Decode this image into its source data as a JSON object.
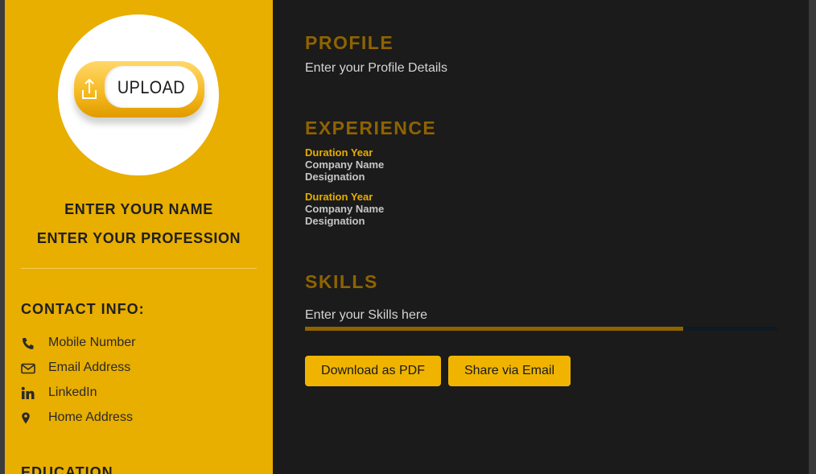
{
  "sidebar": {
    "upload_label": "UPLOAD",
    "name": "ENTER YOUR NAME",
    "profession": "ENTER YOUR PROFESSION",
    "contact_title": "CONTACT INFO:",
    "contacts": [
      {
        "icon": "phone-icon",
        "label": "Mobile Number"
      },
      {
        "icon": "envelope-icon",
        "label": "Email Address"
      },
      {
        "icon": "linkedin-icon",
        "label": "LinkedIn"
      },
      {
        "icon": "map-marker-icon",
        "label": "Home Address"
      }
    ],
    "education_title": "EDUCATION"
  },
  "main": {
    "profile": {
      "title": "PROFILE",
      "text": "Enter your Profile Details"
    },
    "experience": {
      "title": "EXPERIENCE",
      "items": [
        {
          "year": "Duration Year",
          "company": "Company Name",
          "designation": "Designation"
        },
        {
          "year": "Duration Year",
          "company": "Company Name",
          "designation": "Designation"
        }
      ]
    },
    "skills": {
      "title": "SKILLS",
      "text": "Enter your Skills here",
      "level": 0.8
    },
    "buttons": {
      "download_pdf": "Download as PDF",
      "share_email": "Share via Email"
    }
  },
  "colors": {
    "sidebar_bg": "#e8ae00",
    "main_bg": "#1b1b1b",
    "accent_heading": "#8f6300",
    "accent_label": "#e6ad00",
    "button_bg": "#f0b400"
  }
}
